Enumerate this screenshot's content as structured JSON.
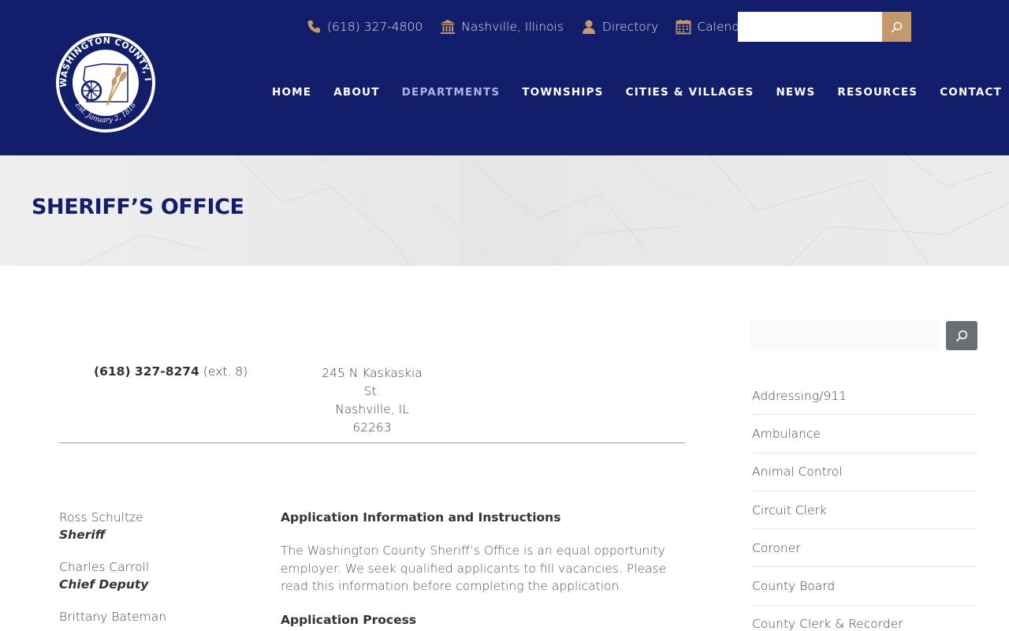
{
  "logo": {
    "arc_top": "WASHINGTON COUNTY, IL",
    "arc_bottom": "Est. January 2, 1818"
  },
  "topbar": {
    "phone": "(618) 327-4800",
    "location": "Nashville, Illinois",
    "directory": "Directory",
    "calendar": "Calendar",
    "search_placeholder": ""
  },
  "nav": {
    "items": [
      "HOME",
      "ABOUT",
      "DEPARTMENTS",
      "TOWNSHIPS",
      "CITIES & VILLAGES",
      "NEWS",
      "RESOURCES",
      "CONTACT"
    ],
    "active": "DEPARTMENTS"
  },
  "page": {
    "title": "SHERIFF’S OFFICE"
  },
  "contact": {
    "phone": "(618) 327-8274",
    "ext": "(ext. 8)",
    "address_line1": "245 N Kaskaskia St.",
    "address_line2": "Nashville, IL 62263"
  },
  "staff": [
    {
      "name": "Ross Schultze",
      "title": "Sheriff"
    },
    {
      "name": "Charles Carroll",
      "title": "Chief Deputy"
    },
    {
      "name": "Brittany Bateman",
      "title": ""
    }
  ],
  "application": {
    "heading": "Application Information and Instructions",
    "body": "The Washington County Sheriff’s Office is an equal opportunity employer. We seek qualified applicants to fill vacancies. Please read this information before completing the application.",
    "process_heading": "Application Process"
  },
  "sidebar": {
    "search_placeholder": "",
    "items": [
      "Addressing/911",
      "Ambulance",
      "Animal Control",
      "Circuit Clerk",
      "Coroner",
      "County Board",
      "County Clerk & Recorder"
    ]
  },
  "colors": {
    "header_bg": "#131e6a",
    "accent_gold": "#c49a6c",
    "active_nav": "#aab3e6",
    "sidebar_button": "#6b6e73"
  }
}
